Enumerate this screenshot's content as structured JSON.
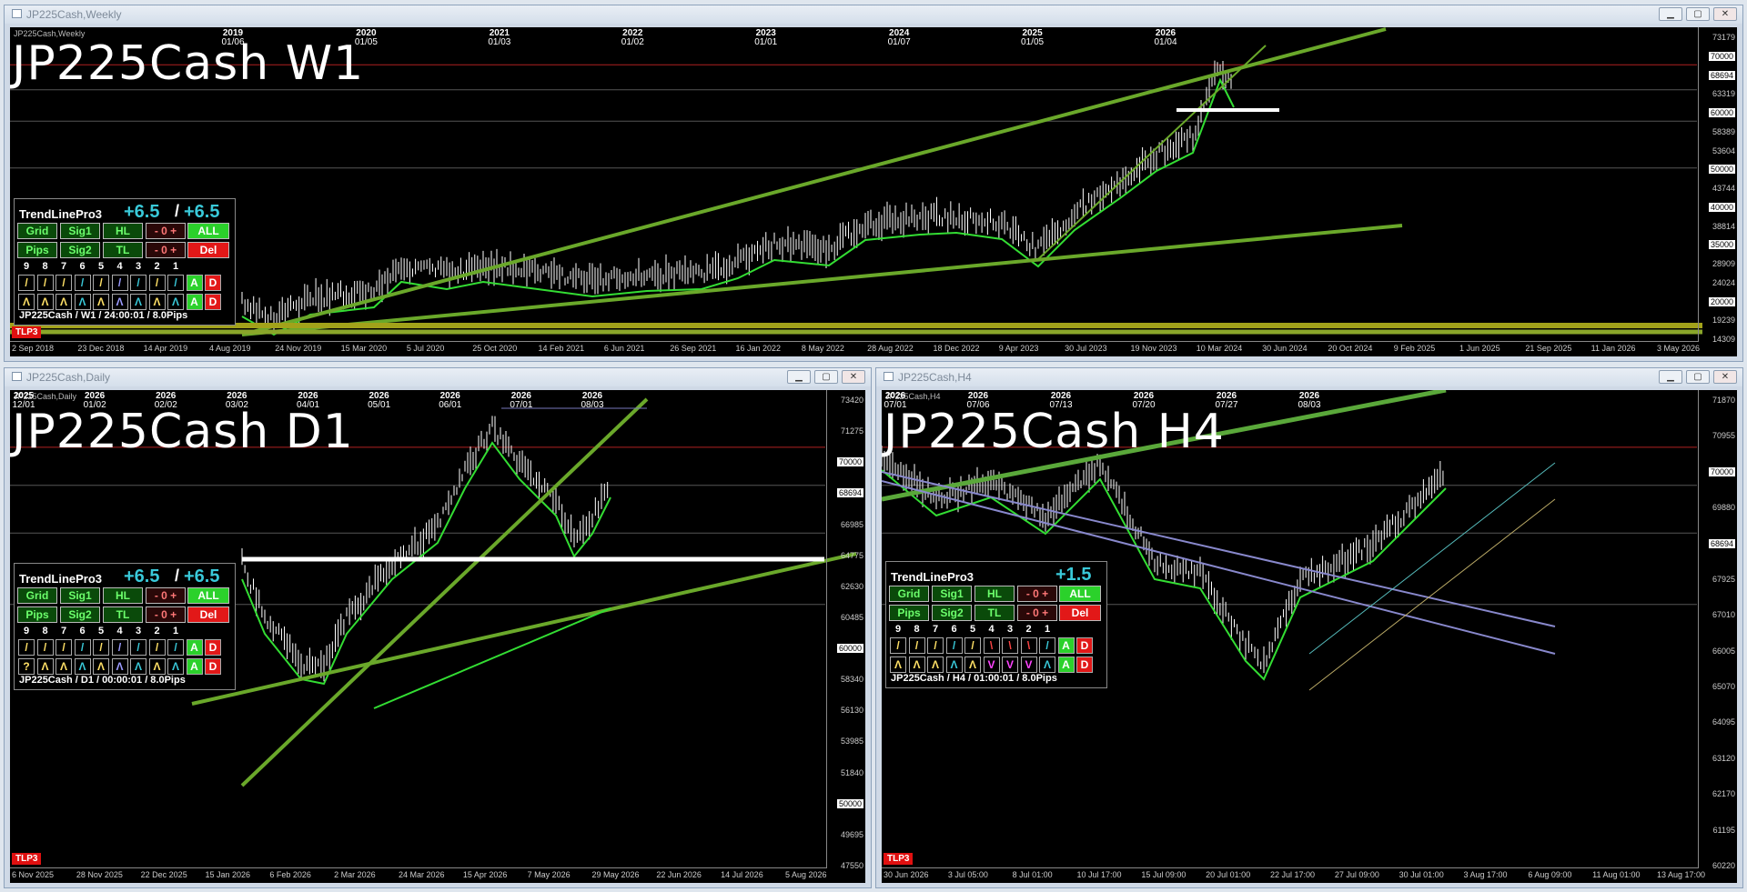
{
  "windows": [
    {
      "id": "w1",
      "title": "JP225Cash,Weekly",
      "small_tag": "JP225Cash,Weekly",
      "big_title": "JP225Cash  W1",
      "timeframe": "W1",
      "years": [
        {
          "year": "2019",
          "md": "01/06"
        },
        {
          "year": "2020",
          "md": "01/05"
        },
        {
          "year": "2021",
          "md": "01/03"
        },
        {
          "year": "2022",
          "md": "01/02"
        },
        {
          "year": "2023",
          "md": "01/01"
        },
        {
          "year": "2024",
          "md": "01/07"
        },
        {
          "year": "2025",
          "md": "01/05"
        },
        {
          "year": "2026",
          "md": "01/04"
        }
      ],
      "price_labels": [
        "73179",
        "70000",
        "68694",
        "63319",
        "60000",
        "58389",
        "53604",
        "50000",
        "43744",
        "40000",
        "38814",
        "35000",
        "28909",
        "24024",
        "20000",
        "19239",
        "14309"
      ],
      "date_labels": [
        "2 Sep 2018",
        "23 Dec 2018",
        "14 Apr 2019",
        "4 Aug 2019",
        "24 Nov 2019",
        "15 Mar 2020",
        "5 Jul 2020",
        "25 Oct 2020",
        "14 Feb 2021",
        "6 Jun 2021",
        "26 Sep 2021",
        "16 Jan 2022",
        "8 May 2022",
        "28 Aug 2022",
        "18 Dec 2022",
        "9 Apr 2023",
        "30 Jul 2023",
        "19 Nov 2023",
        "10 Mar 2024",
        "30 Jun 2024",
        "20 Oct 2024",
        "9 Feb 2025",
        "1 Jun 2025",
        "21 Sep 2025",
        "11 Jan 2026",
        "3 May 2026"
      ],
      "tag": "TLP3",
      "panel": {
        "name": "TrendLinePro3",
        "val1": "+6.5",
        "sep": "/",
        "val2": "+6.5",
        "buttons": {
          "grid": "Grid",
          "sig1": "Sig1",
          "hl": "HL",
          "zero1": "- 0 +",
          "all": "ALL",
          "pips": "Pips",
          "sig2": "Sig2",
          "tl": "TL",
          "zero2": "- 0 +",
          "del": "Del"
        },
        "numbers": [
          "9",
          "8",
          "7",
          "6",
          "5",
          "4",
          "3",
          "2",
          "1"
        ],
        "row1": [
          "/",
          "/",
          "/",
          "/",
          "/",
          "/",
          "/",
          "/",
          "/",
          "A",
          "D"
        ],
        "row2": [
          "Λ",
          "Λ",
          "Λ",
          "Λ",
          "Λ",
          "Λ",
          "Λ",
          "Λ",
          "Λ",
          "A",
          "D"
        ],
        "footer": "JP225Cash / W1 / 24:00:01 / 8.0Pips"
      }
    },
    {
      "id": "d1",
      "title": "JP225Cash,Daily",
      "small_tag": "JP225Cash,Daily",
      "big_title": "JP225Cash  D1",
      "timeframe": "D1",
      "years": [
        {
          "year": "2025",
          "md": "12/01"
        },
        {
          "year": "2026",
          "md": "01/02"
        },
        {
          "year": "2026",
          "md": "02/02"
        },
        {
          "year": "2026",
          "md": "03/02"
        },
        {
          "year": "2026",
          "md": "04/01"
        },
        {
          "year": "2026",
          "md": "05/01"
        },
        {
          "year": "2026",
          "md": "06/01"
        },
        {
          "year": "2026",
          "md": "07/01"
        },
        {
          "year": "2026",
          "md": "08/03"
        }
      ],
      "price_labels": [
        "73420",
        "71275",
        "70000",
        "68694",
        "66985",
        "64775",
        "62630",
        "60485",
        "60000",
        "58340",
        "56130",
        "53985",
        "51840",
        "50000",
        "49695",
        "47550"
      ],
      "date_labels": [
        "6 Nov 2025",
        "28 Nov 2025",
        "22 Dec 2025",
        "15 Jan 2026",
        "6 Feb 2026",
        "2 Mar 2026",
        "24 Mar 2026",
        "15 Apr 2026",
        "7 May 2026",
        "29 May 2026",
        "22 Jun 2026",
        "14 Jul 2026",
        "5 Aug 2026"
      ],
      "tag": "TLP3",
      "panel": {
        "name": "TrendLinePro3",
        "val1": "+6.5",
        "sep": "/",
        "val2": "+6.5",
        "buttons": {
          "grid": "Grid",
          "sig1": "Sig1",
          "hl": "HL",
          "zero1": "- 0 +",
          "all": "ALL",
          "pips": "Pips",
          "sig2": "Sig2",
          "tl": "TL",
          "zero2": "- 0 +",
          "del": "Del"
        },
        "numbers": [
          "9",
          "8",
          "7",
          "6",
          "5",
          "4",
          "3",
          "2",
          "1"
        ],
        "row1": [
          "/",
          "/",
          "/",
          "/",
          "/",
          "/",
          "/",
          "/",
          "/",
          "A",
          "D"
        ],
        "row2": [
          "?",
          "Λ",
          "Λ",
          "Λ",
          "Λ",
          "Λ",
          "Λ",
          "Λ",
          "Λ",
          "A",
          "D"
        ],
        "footer": "JP225Cash / D1 / 00:00:01 / 8.0Pips"
      }
    },
    {
      "id": "h4",
      "title": "JP225Cash,H4",
      "small_tag": "JP225Cash,H4",
      "big_title": "JP225Cash  H4",
      "timeframe": "H4",
      "years": [
        {
          "year": "2026",
          "md": "07/01"
        },
        {
          "year": "2026",
          "md": "07/06"
        },
        {
          "year": "2026",
          "md": "07/13"
        },
        {
          "year": "2026",
          "md": "07/20"
        },
        {
          "year": "2026",
          "md": "07/27"
        },
        {
          "year": "2026",
          "md": "08/03"
        }
      ],
      "price_labels": [
        "71870",
        "70955",
        "70000",
        "69880",
        "68694",
        "67925",
        "67010",
        "66005",
        "65070",
        "64095",
        "63120",
        "62170",
        "61195",
        "60220"
      ],
      "date_labels": [
        "30 Jun 2026",
        "3 Jul 05:00",
        "8 Jul 01:00",
        "10 Jul 17:00",
        "15 Jul 09:00",
        "20 Jul 01:00",
        "22 Jul 17:00",
        "27 Jul 09:00",
        "30 Jul 01:00",
        "3 Aug 17:00",
        "6 Aug 09:00",
        "11 Aug 01:00",
        "13 Aug 17:00"
      ],
      "tag": "TLP3",
      "panel": {
        "name": "TrendLinePro3",
        "val1": "",
        "sep": "",
        "val2": "+1.5",
        "buttons": {
          "grid": "Grid",
          "sig1": "Sig1",
          "hl": "HL",
          "zero1": "- 0 +",
          "all": "ALL",
          "pips": "Pips",
          "sig2": "Sig2",
          "tl": "TL",
          "zero2": "- 0 +",
          "del": "Del"
        },
        "numbers": [
          "9",
          "8",
          "7",
          "6",
          "5",
          "4",
          "3",
          "2",
          "1"
        ],
        "row1": [
          "/",
          "/",
          "/",
          "/",
          "/",
          "\\",
          "\\",
          "\\",
          "/",
          "A",
          "D"
        ],
        "row2": [
          "Λ",
          "Λ",
          "Λ",
          "Λ",
          "Λ",
          "V",
          "V",
          "V",
          "Λ",
          "A",
          "D"
        ],
        "footer": "JP225Cash / H4 / 01:00:01 / 8.0Pips"
      }
    }
  ],
  "colors": {
    "accent_cyan": "#39c9d9",
    "sig_green": "#2bd12b",
    "del_red": "#e21818",
    "trend_green": "#6aa82a"
  }
}
